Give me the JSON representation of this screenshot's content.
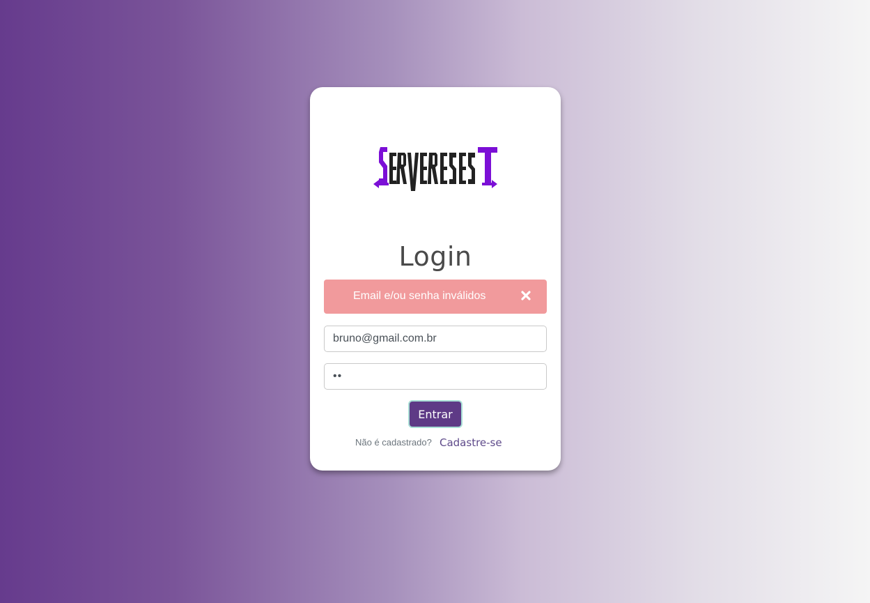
{
  "brand": {
    "logo_text": "SERVEREST",
    "accent_color": "#7b0fd6",
    "text_color": "#222222"
  },
  "login": {
    "title": "Login",
    "alert": {
      "message": "Email e/ou senha inválidos",
      "close_icon": "close-icon",
      "color": "#f19a9c"
    },
    "email_value": "bruno@gmail.com.br",
    "password_value": "••",
    "submit_label": "Entrar",
    "signup_question": "Não é cadastrado?",
    "signup_link": "Cadastre-se"
  },
  "colors": {
    "button": "#5e3a86",
    "button_border": "#a9dfd6"
  }
}
